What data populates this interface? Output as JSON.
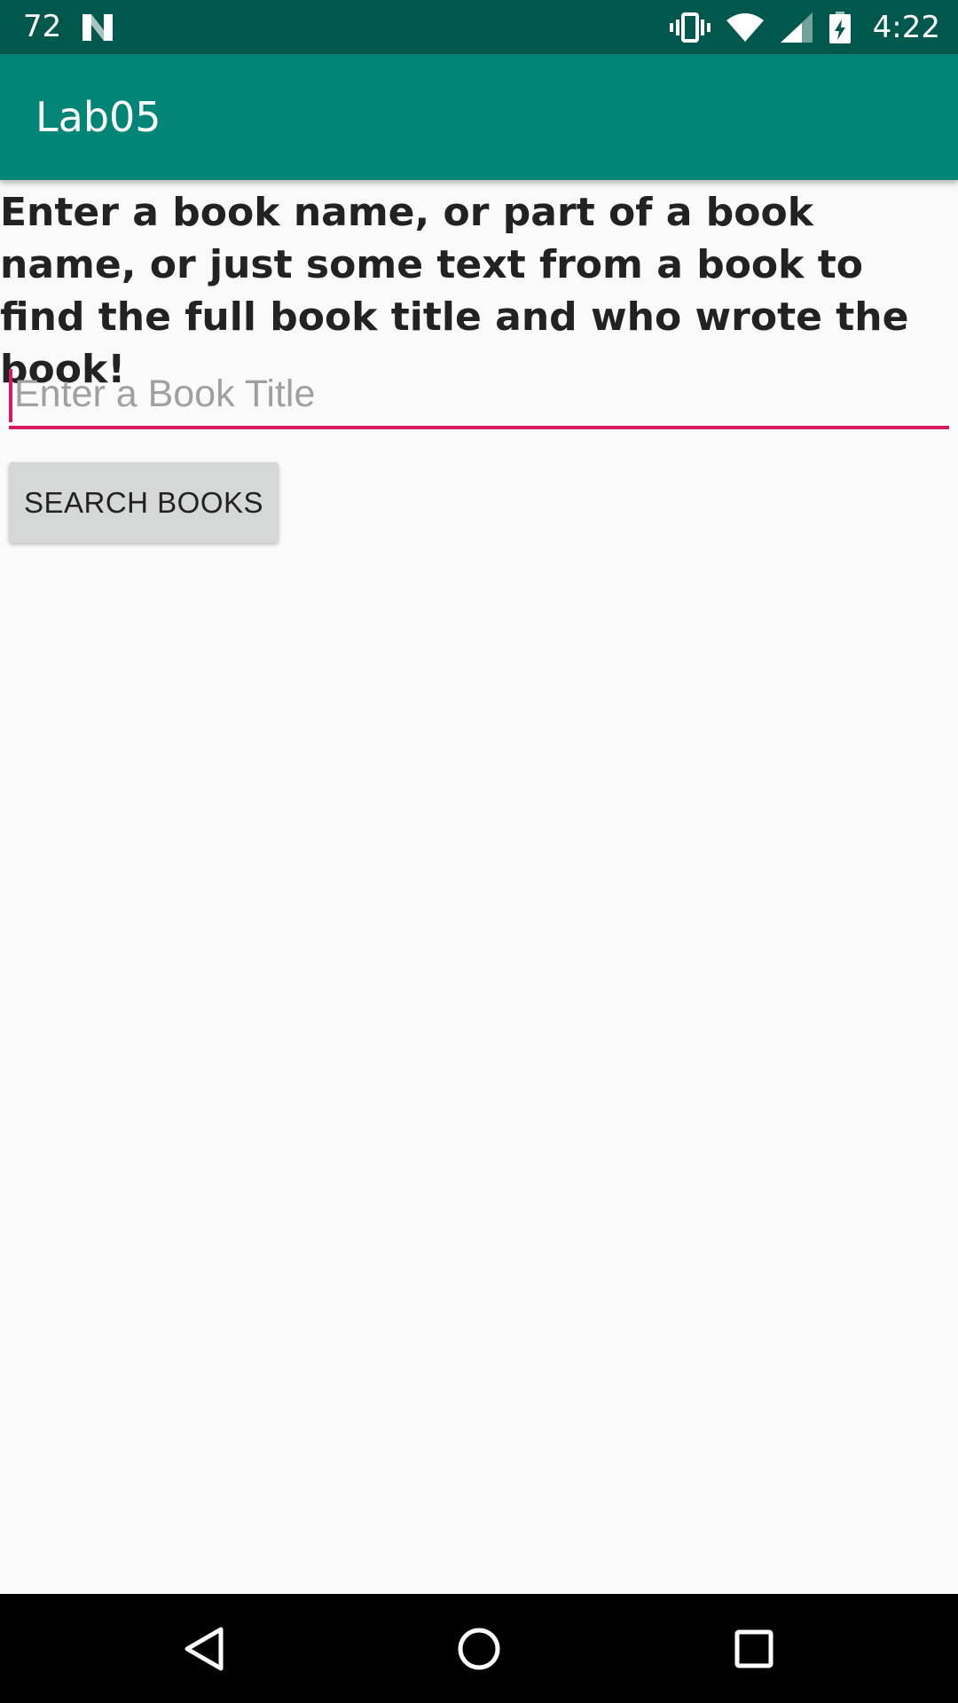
{
  "status_bar": {
    "temperature": "72",
    "time": "4:22",
    "icons": [
      "notification-n-icon",
      "vibrate-icon",
      "wifi-icon",
      "signal-icon",
      "battery-charging-icon"
    ]
  },
  "app_bar": {
    "title": "Lab05"
  },
  "main": {
    "instructions": "Enter a book name, or part of a book name, or just some text from a book to find the full book title and who wrote the book!",
    "book_input": {
      "value": "",
      "placeholder": "Enter a Book Title"
    },
    "search_button_label": "SEARCH BOOKS"
  },
  "nav_bar": {
    "buttons": [
      "back-icon",
      "home-icon",
      "recents-icon"
    ]
  },
  "colors": {
    "status_bar": "#00574b",
    "app_bar": "#008577",
    "accent": "#d81b60",
    "background": "#fafafa",
    "button": "#d6d7d7"
  }
}
